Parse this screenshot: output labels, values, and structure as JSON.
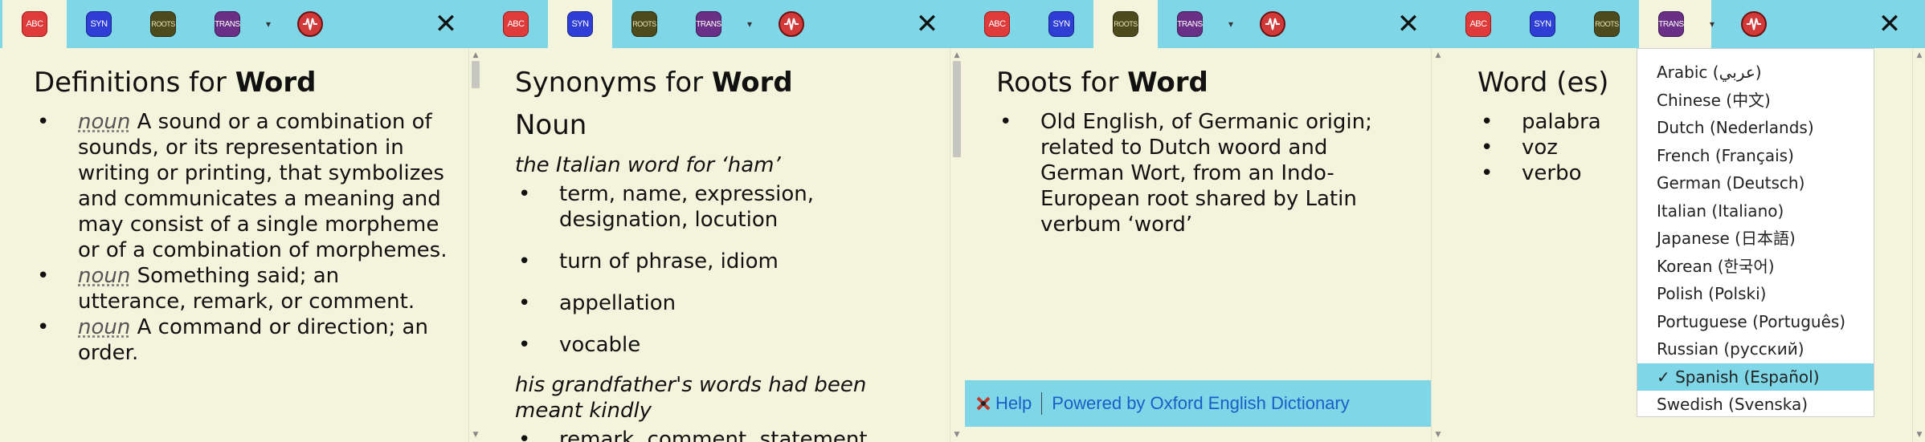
{
  "icons": {
    "abc": "ABC",
    "syn": "SYN",
    "roots": "ROOTS",
    "trans": "TRANS",
    "close": "✕",
    "caret": "▾"
  },
  "colors": {
    "toolbar": "#7ed6e6",
    "background": "#f4f4dc",
    "link": "#1a5ec8"
  },
  "definitions": {
    "title_prefix": "Definitions for ",
    "word": "Word",
    "items": [
      {
        "pos": "noun",
        "text": " A sound or a combination of sounds, or its representation in writing or printing, that symbolizes and communicates a meaning and may consist of a single morpheme or of a combination of morphemes."
      },
      {
        "pos": "noun",
        "text": " Something said; an utterance, remark, or comment."
      },
      {
        "pos": "noun",
        "text": " A command or direction; an order."
      }
    ]
  },
  "synonyms": {
    "title_prefix": "Synonyms for ",
    "word": "Word",
    "subhead": "Noun",
    "example1": "the Italian word for ‘ham’",
    "group1": [
      "term, name, expression, designation, locution",
      "turn of phrase, idiom",
      "appellation",
      "vocable"
    ],
    "example2": "his grandfather's words had been meant kindly",
    "group2": [
      "remark, comment, statement"
    ]
  },
  "roots": {
    "title_prefix": "Roots for ",
    "word": "Word",
    "items": [
      "Old English, of Germanic origin; related to Dutch woord and German Wort, from an Indo-European root shared by Latin verbum ‘word’"
    ],
    "footer": {
      "help": "Help",
      "powered": "Powered by Oxford English Dictionary"
    }
  },
  "translations": {
    "title": "Word (es)",
    "items": [
      "palabra",
      "voz",
      "verbo"
    ],
    "languages": [
      "Arabic (عربي)",
      "Chinese (中文)",
      "Dutch (Nederlands)",
      "French (Français)",
      "German (Deutsch)",
      "Italian (Italiano)",
      "Japanese (日本語)",
      "Korean (한국어)",
      "Polish (Polski)",
      "Portuguese (Português)",
      "Russian (русский)",
      "✓ Spanish (Español)",
      "Swedish (Svenska)"
    ],
    "selected_index": 11
  }
}
